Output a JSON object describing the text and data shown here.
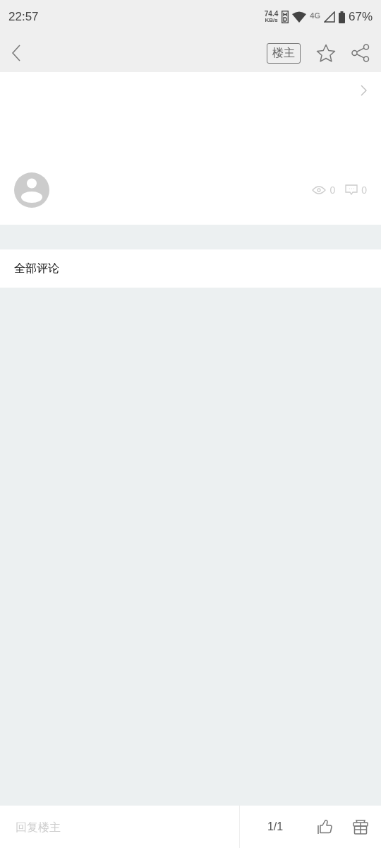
{
  "status_bar": {
    "time": "22:57",
    "speed": "74.4",
    "speed_unit": "KB/s",
    "network": "4G",
    "battery": "67%"
  },
  "nav": {
    "owner_button": "楼主"
  },
  "post": {
    "views": "0",
    "comments": "0"
  },
  "comments_header": "全部评论",
  "bottom_bar": {
    "placeholder": "回复楼主",
    "page": "1/1"
  }
}
